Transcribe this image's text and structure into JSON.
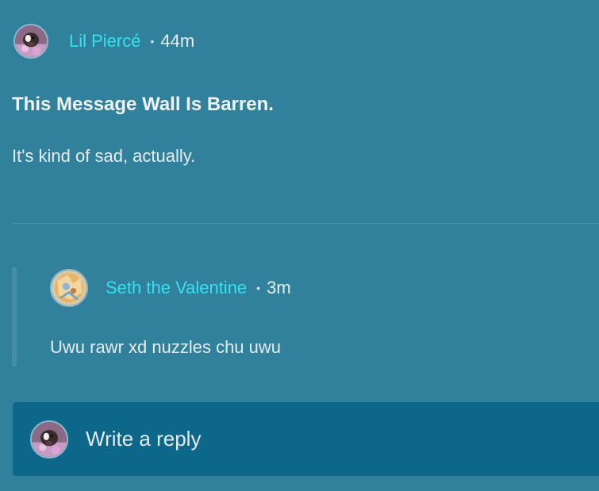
{
  "post": {
    "author": "Lil Piercé",
    "separator": "•",
    "time": "44m",
    "title": "This Message Wall Is Barren.",
    "body": "It's kind of sad, actually.",
    "avatar_icon": "user-avatar-icon"
  },
  "reply": {
    "author": "Seth the Valentine",
    "separator": "•",
    "time": "3m",
    "body": "Uwu rawr xd nuzzles chu uwu",
    "avatar_icon": "user-avatar-icon"
  },
  "reply_box": {
    "placeholder": "Write a reply",
    "avatar_icon": "user-avatar-icon"
  },
  "colors": {
    "background": "#32819c",
    "link": "#35e0f0",
    "reply_box": "#0d678a"
  }
}
